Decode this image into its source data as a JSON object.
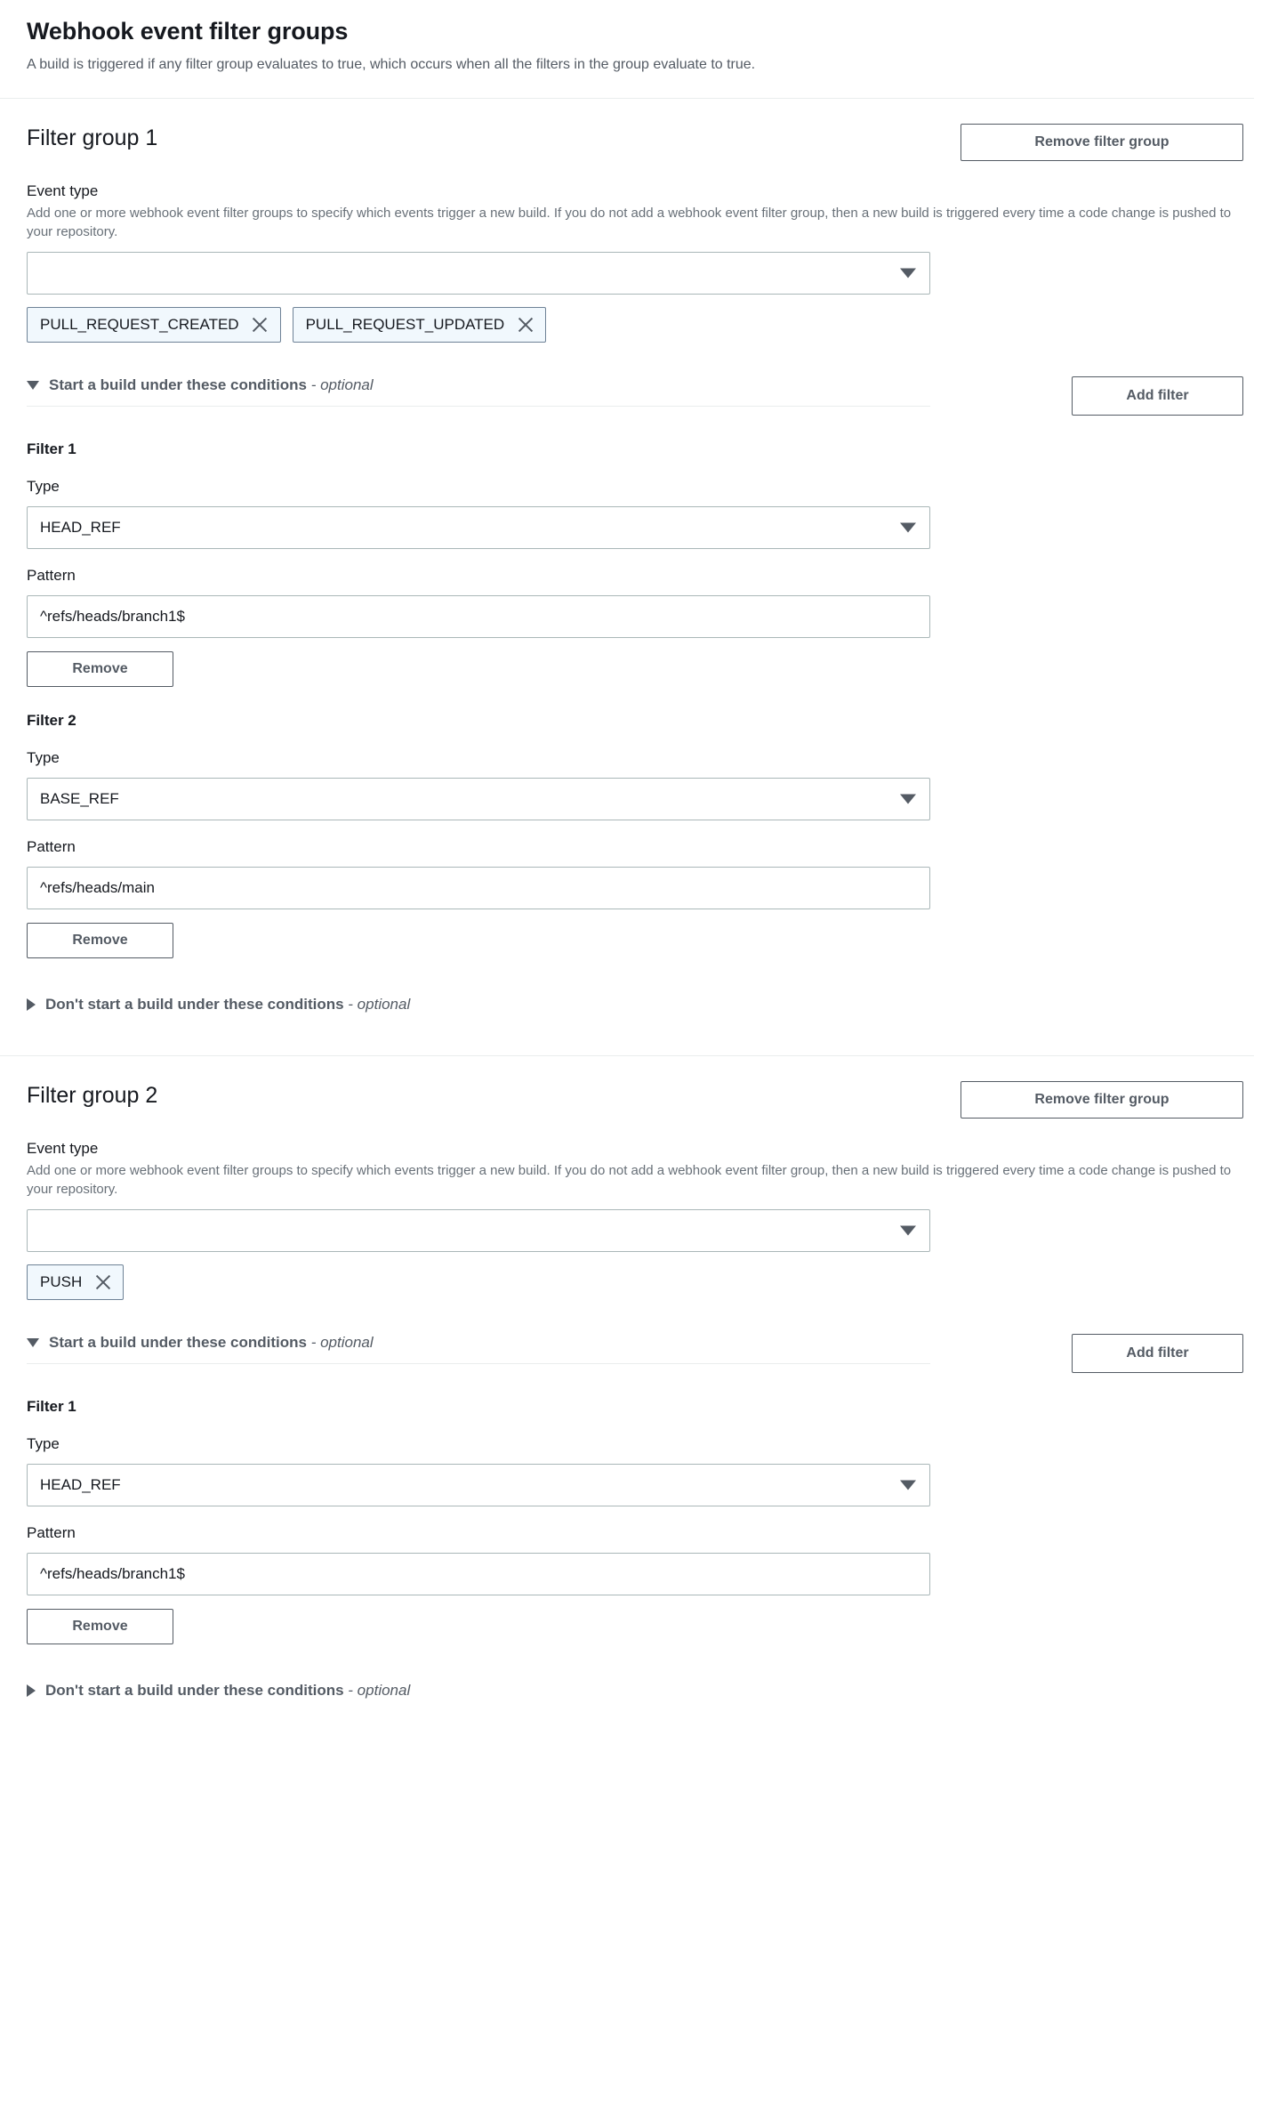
{
  "header": {
    "title": "Webhook event filter groups",
    "description": "A build is triggered if any filter group evaluates to true, which occurs when all the filters in the group evaluate to true."
  },
  "labels": {
    "event_type": "Event type",
    "event_type_description": "Add one or more webhook event filter groups to specify which events trigger a new build. If you do not add a webhook event filter group, then a new build is triggered every time a code change is pushed to your repository.",
    "type": "Type",
    "pattern": "Pattern",
    "remove_filter_group": "Remove filter group",
    "add_filter": "Add filter",
    "remove": "Remove",
    "start_build": "Start a build under these conditions",
    "dont_start_build": "Don't start a build under these conditions",
    "optional_suffix": "- optional"
  },
  "colors": {
    "token_background": "#f1f8fd",
    "token_border": "#6e8296",
    "border": "#aab7b8",
    "text": "#16191f",
    "muted_text": "#545b64",
    "divider": "#eaeded"
  },
  "icons": {
    "chevron_down": "caret-down-icon",
    "expanded": "triangle-down-icon",
    "collapsed": "triangle-right-icon",
    "token_remove": "close-x-icon"
  },
  "groups": [
    {
      "title": "Filter group 1",
      "event_type_value": "",
      "event_type_placeholder": "",
      "tokens": [
        "PULL_REQUEST_CREATED",
        "PULL_REQUEST_UPDATED"
      ],
      "start_expanded": true,
      "dont_start_expanded": false,
      "filters": [
        {
          "title": "Filter 1",
          "type_value": "HEAD_REF",
          "pattern_value": "^refs/heads/branch1$"
        },
        {
          "title": "Filter 2",
          "type_value": "BASE_REF",
          "pattern_value": "^refs/heads/main"
        }
      ]
    },
    {
      "title": "Filter group 2",
      "event_type_value": "",
      "event_type_placeholder": "",
      "tokens": [
        "PUSH"
      ],
      "start_expanded": true,
      "dont_start_expanded": false,
      "filters": [
        {
          "title": "Filter 1",
          "type_value": "HEAD_REF",
          "pattern_value": "^refs/heads/branch1$"
        }
      ]
    }
  ]
}
